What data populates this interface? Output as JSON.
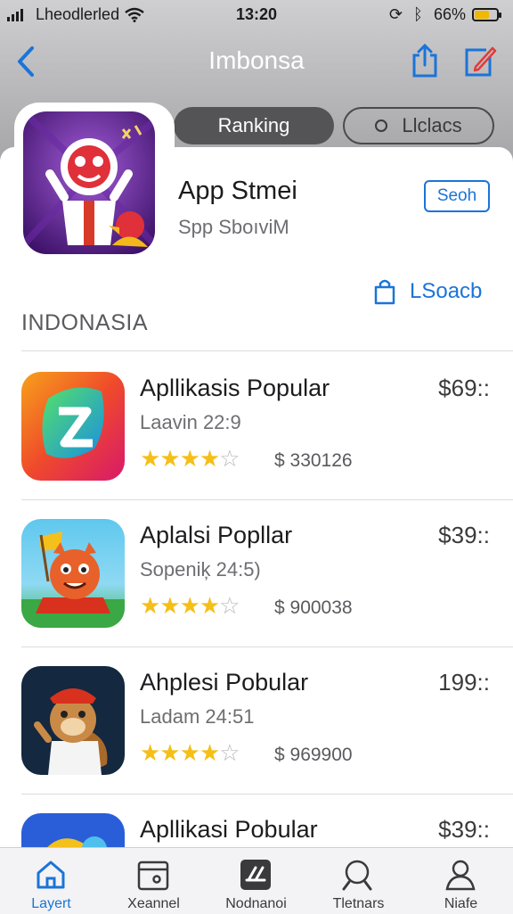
{
  "status_bar": {
    "carrier": "Lheodlerled",
    "time": "13:20",
    "battery_pct": "66%",
    "battery_level": 0.66
  },
  "nav": {
    "title": "Imbonsa"
  },
  "segments": {
    "ranking": "Ranking",
    "second_icon": "o",
    "second": "Llclacs"
  },
  "featured": {
    "title": "App Stmei",
    "subtitle": "Spp SboıviM",
    "search_label": "Seoh",
    "link_label": "LSoacb"
  },
  "section_title": "INDONASIA",
  "apps": [
    {
      "title": "Apllikasis Popular",
      "subtitle": "Laavin 22:9",
      "stars": "★★★★",
      "empty_star": "☆",
      "rating": 4,
      "count": "$ 330126",
      "price": "$69::"
    },
    {
      "title": "Aplalsi Popllar",
      "subtitle": "Sopeniķ 24:5)",
      "stars": "★★★★",
      "empty_star": "☆",
      "rating": 4,
      "count": "$ 900038",
      "price": "$39::"
    },
    {
      "title": "Ahplesi Pobular",
      "subtitle": "Ladam 24:51",
      "stars": "★★★★",
      "empty_star": "☆",
      "rating": 4,
      "count": "$ 969900",
      "price": "199::"
    },
    {
      "title": "Apllikasi Pobular",
      "price": "$39::"
    }
  ],
  "tabs": [
    {
      "label": "Layert",
      "icon": "home-icon",
      "active": true
    },
    {
      "label": "Xeannel",
      "icon": "calendar-icon",
      "active": false
    },
    {
      "label": "Nodnanoi",
      "icon": "apps-icon",
      "active": false
    },
    {
      "label": "Tletnars",
      "icon": "search-icon",
      "active": false
    },
    {
      "label": "Niafe",
      "icon": "person-icon",
      "active": false
    }
  ],
  "colors": {
    "accent": "#1b74d8",
    "star": "#f5bf18",
    "battery": "#f0b800"
  }
}
